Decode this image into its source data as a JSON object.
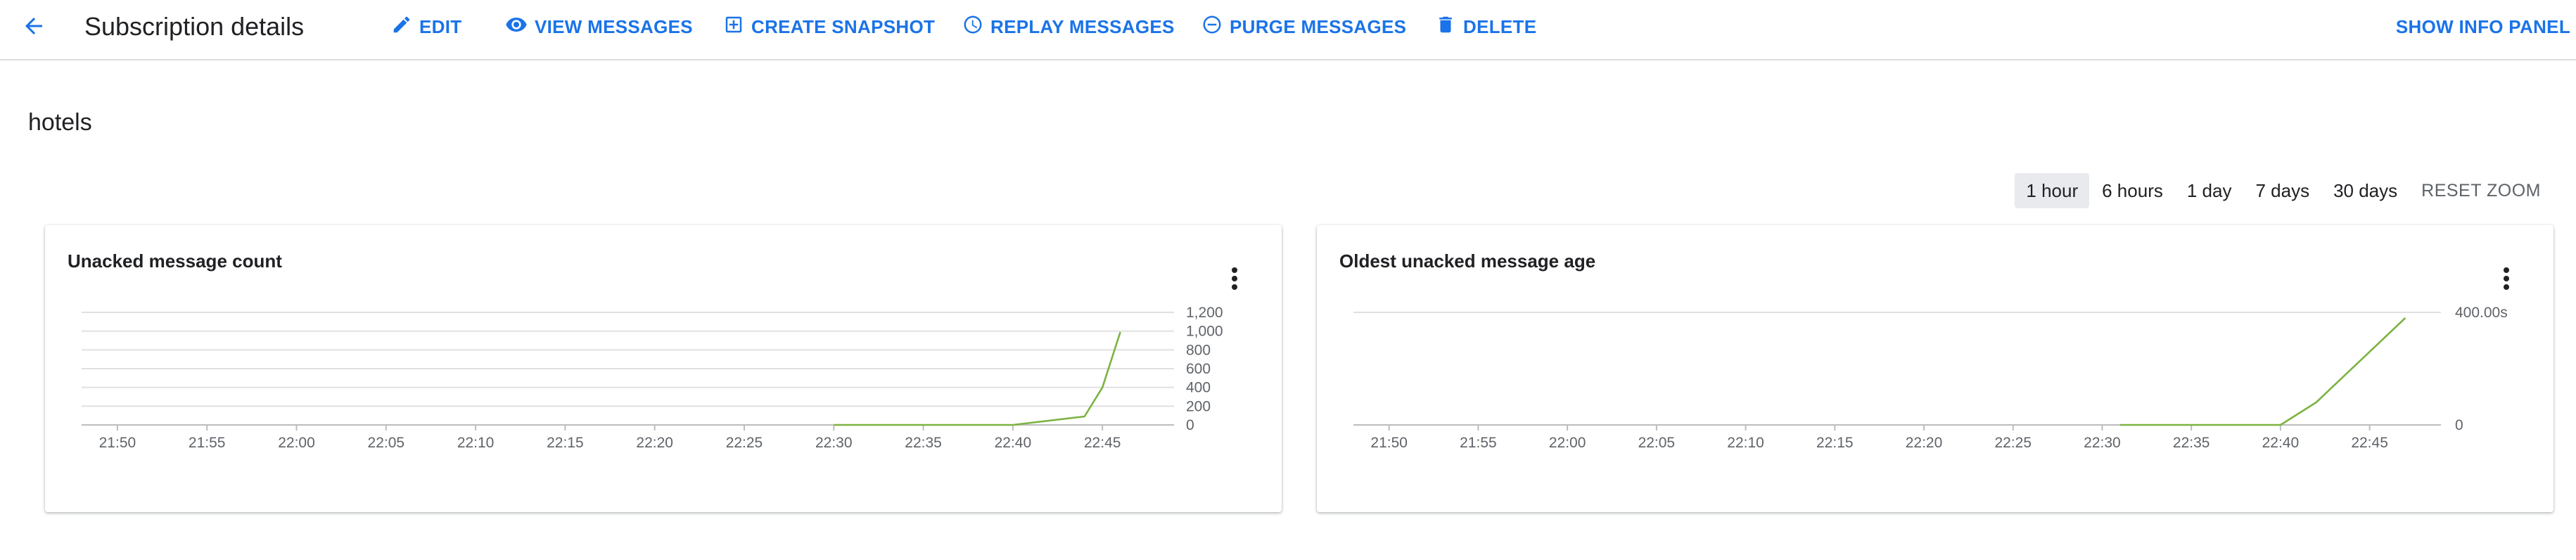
{
  "header": {
    "title": "Subscription details",
    "actions": {
      "edit": "EDIT",
      "view_messages": "VIEW MESSAGES",
      "create_snapshot": "CREATE SNAPSHOT",
      "replay_messages": "REPLAY MESSAGES",
      "purge_messages": "PURGE MESSAGES",
      "delete": "DELETE",
      "show_info_panel": "SHOW INFO PANEL"
    },
    "icons": {
      "back": "arrow-back-icon",
      "edit": "pencil-icon",
      "view_messages": "eye-icon",
      "create_snapshot": "add-box-icon",
      "replay_messages": "clock-icon",
      "purge_messages": "minus-circle-icon",
      "delete": "trash-icon"
    }
  },
  "subscription_name": "hotels",
  "time_range": {
    "options": [
      "1 hour",
      "6 hours",
      "1 day",
      "7 days",
      "30 days"
    ],
    "selected": "1 hour",
    "reset_zoom": "RESET ZOOM"
  },
  "colors": {
    "accent": "#1a73e8",
    "series": "#7cb342"
  },
  "chart_data": [
    {
      "type": "line",
      "title": "Unacked message count",
      "menu_icon": "more-vert-icon",
      "x_ticks": [
        "21:50",
        "21:55",
        "22:00",
        "22:05",
        "22:10",
        "22:15",
        "22:20",
        "22:25",
        "22:30",
        "22:35",
        "22:40",
        "22:45"
      ],
      "x_range": [
        "21:48",
        "22:49"
      ],
      "y_ticks": [
        "0",
        "200",
        "400",
        "600",
        "800",
        "1,000",
        "1,200"
      ],
      "y_tick_values": [
        0,
        200,
        400,
        600,
        800,
        1000,
        1200
      ],
      "ylim": [
        0,
        1200
      ],
      "y_axis_side": "right",
      "grid": true,
      "series": [
        {
          "x": [
            "22:30",
            "22:35",
            "22:40",
            "22:44",
            "22:45",
            "22:46"
          ],
          "y": [
            0,
            0,
            0,
            90,
            400,
            990
          ]
        }
      ]
    },
    {
      "type": "line",
      "title": "Oldest unacked message age",
      "menu_icon": "more-vert-icon",
      "x_ticks": [
        "21:50",
        "21:55",
        "22:00",
        "22:05",
        "22:10",
        "22:15",
        "22:20",
        "22:25",
        "22:30",
        "22:35",
        "22:40",
        "22:45"
      ],
      "x_range": [
        "21:48",
        "22:49"
      ],
      "y_ticks": [
        "0",
        "400.00s"
      ],
      "y_tick_values": [
        0,
        400
      ],
      "ylim": [
        0,
        400
      ],
      "y_axis_side": "right",
      "grid": true,
      "series": [
        {
          "x": [
            "22:31",
            "22:40",
            "22:42",
            "22:47"
          ],
          "y": [
            0,
            0,
            80,
            380
          ]
        }
      ]
    }
  ]
}
